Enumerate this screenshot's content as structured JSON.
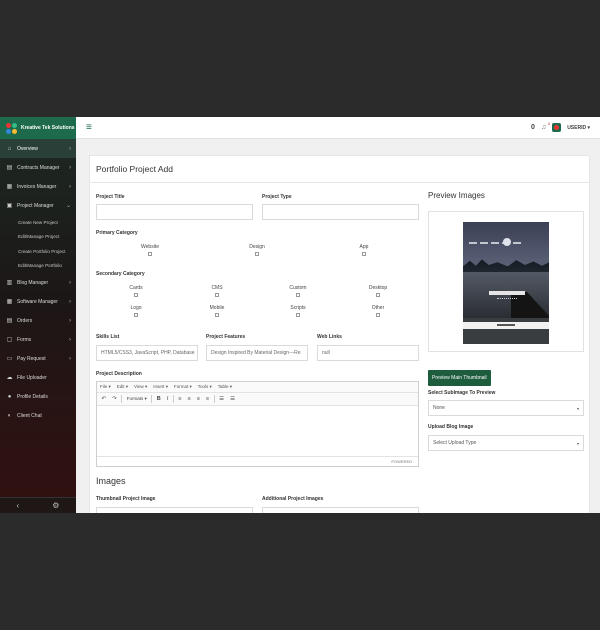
{
  "brand": {
    "name": "Kreative Tek Solutions"
  },
  "sidebar": {
    "items": [
      {
        "label": "Overview",
        "icon": "home-icon",
        "glyph": "⌂",
        "chevron": "›"
      },
      {
        "label": "Contracts Manager",
        "icon": "document-icon",
        "glyph": "▤",
        "chevron": "›"
      },
      {
        "label": "Invoices Manager",
        "icon": "invoice-icon",
        "glyph": "▦",
        "chevron": "›"
      },
      {
        "label": "Project Manager",
        "icon": "folder-icon",
        "glyph": "▣",
        "chevron": "⌄"
      },
      {
        "label": "Blog Manager",
        "icon": "blog-icon",
        "glyph": "▥",
        "chevron": "›"
      },
      {
        "label": "Software Manager",
        "icon": "software-icon",
        "glyph": "▦",
        "chevron": "›"
      },
      {
        "label": "Orders",
        "icon": "orders-icon",
        "glyph": "▤",
        "chevron": "›"
      },
      {
        "label": "Forms",
        "icon": "forms-icon",
        "glyph": "▢",
        "chevron": "›"
      },
      {
        "label": "Pay Request",
        "icon": "pay-icon",
        "glyph": "▭",
        "chevron": "›"
      },
      {
        "label": "File Uploader",
        "icon": "upload-icon",
        "glyph": "☁",
        "chevron": ""
      },
      {
        "label": "Profile Details",
        "icon": "user-icon",
        "glyph": "●",
        "chevron": ""
      },
      {
        "label": "Client Chat",
        "icon": "chat-icon",
        "glyph": "◐",
        "chevron": ""
      }
    ],
    "project_sub": [
      "Create New Project",
      "Edit/Manage Project",
      "Create Portfolio Project",
      "Edit/Manage Portfolio"
    ],
    "footer": {
      "collapse": "‹",
      "settings": "⚙"
    }
  },
  "topbar": {
    "menu_glyph": "≡",
    "counter": "0",
    "bell_glyph": "♫",
    "notif": "0",
    "user": "USERID",
    "caret": "▾"
  },
  "page": {
    "title": "Portfolio Project Add"
  },
  "form": {
    "project_title_label": "Project Title",
    "project_title_value": "",
    "project_type_label": "Project Type",
    "project_type_value": "",
    "primary_category_label": "Primary Category",
    "primary": [
      "Website",
      "Design",
      "App"
    ],
    "secondary_category_label": "Secondary Category",
    "secondary_row1": [
      "Cards",
      "CMS",
      "Custom",
      "Desktop"
    ],
    "secondary_row2": [
      "Logo",
      "Mobile",
      "Scripts",
      "Other"
    ],
    "skills_label": "Skills List",
    "skills_value": "HTML5/CSS3, JavaScript, PHP, Database",
    "features_label": "Project Features",
    "features_value": "Design Inspired By Material Design---Re",
    "weblinks_label": "Web Links",
    "weblinks_value": "null",
    "description_label": "Project Description"
  },
  "editor": {
    "menu": [
      "File ▾",
      "Edit ▾",
      "View ▾",
      "Insert ▾",
      "Format ▾",
      "Tools ▾",
      "Table ▾"
    ],
    "undo": "↶",
    "redo": "↷",
    "formats": "Formats ▾",
    "bold": "B",
    "italic": "I",
    "align_left": "≡",
    "align_center": "≡",
    "align_right": "≡",
    "justify": "≡",
    "list": "☰",
    "indent": "☰",
    "status": "POWERED"
  },
  "images": {
    "heading": "Images",
    "thumbnail_label": "Thumbnail Project Image",
    "additional_label": "Additional Project Images"
  },
  "preview": {
    "heading": "Preview Images",
    "button": "Preview Main Thumbnail",
    "select_label": "Select SubImage To Preview",
    "select_value": "None",
    "upload_label": "Upload Blog Image",
    "upload_value": "Select Upload Type",
    "caret": "▾"
  }
}
